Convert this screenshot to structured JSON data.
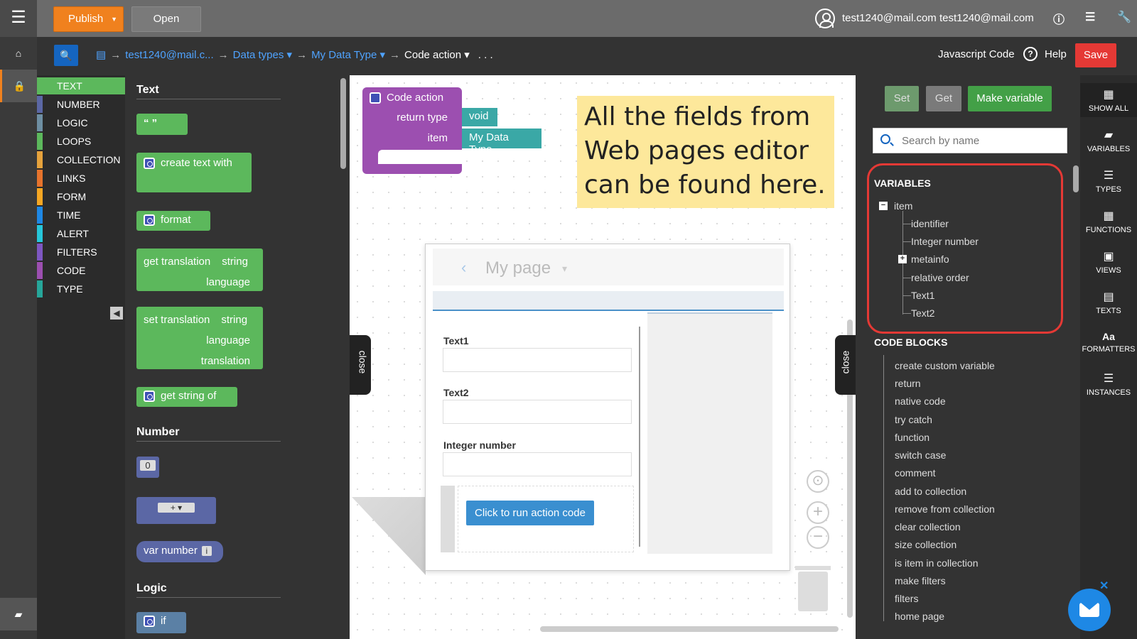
{
  "topbar": {
    "publish_label": "Publish",
    "open_label": "Open",
    "user_email": "test1240@mail.com test1240@mail.com"
  },
  "toolbar": {
    "breadcrumbs": [
      "test1240@mail.c...",
      "Data types",
      "My Data Type",
      "Code action"
    ],
    "more": ". . .",
    "javascript_code": "Javascript Code",
    "help": "Help",
    "save": "Save"
  },
  "categories": [
    {
      "label": "TEXT",
      "color": "#5cb85c"
    },
    {
      "label": "NUMBER",
      "color": "#5b67a5"
    },
    {
      "label": "LOGIC",
      "color": "#6e8fa3"
    },
    {
      "label": "LOOPS",
      "color": "#5cb85c"
    },
    {
      "label": "COLLECTION",
      "color": "#e6a23c"
    },
    {
      "label": "LINKS",
      "color": "#e6732c"
    },
    {
      "label": "FORM",
      "color": "#f5a623"
    },
    {
      "label": "TIME",
      "color": "#1e88e5"
    },
    {
      "label": "ALERT",
      "color": "#26c6da"
    },
    {
      "label": "FILTERS",
      "color": "#7e57c2"
    },
    {
      "label": "CODE",
      "color": "#9c4fb0"
    },
    {
      "label": "TYPE",
      "color": "#26a69a"
    }
  ],
  "flyout": {
    "text_header": "Text",
    "quote_block": "“ ”",
    "create_text_with": "create text with",
    "format": "format",
    "get_translation": "get translation",
    "string": "string",
    "language": "language",
    "set_translation": "set translation",
    "translation": "translation",
    "get_string_of": "get string of",
    "number_header": "Number",
    "zero": "0",
    "plus_op": "+ ▾",
    "var_number": "var number",
    "var_info": "i",
    "logic_header": "Logic",
    "if_label": "if",
    "close": "close"
  },
  "canvas": {
    "code_action": "Code action",
    "return_type": "return type",
    "void": "void",
    "item": "item",
    "my_data_type": "My Data Type",
    "note": "All the fields from Web pages editor can be found here.",
    "page_title": "My page",
    "page_caret": "▾",
    "text1": "Text1",
    "text2": "Text2",
    "integer_number": "Integer number",
    "run_button": "Click to run action code",
    "close": "close"
  },
  "right_panel": {
    "set": "Set",
    "get": "Get",
    "make_variable": "Make variable",
    "search_placeholder": "Search by name",
    "variables_header": "VARIABLES",
    "item": "item",
    "fields": [
      "identifier",
      "Integer number",
      "metainfo",
      "relative order",
      "Text1",
      "Text2"
    ],
    "code_blocks_header": "CODE BLOCKS",
    "code_blocks": [
      "create custom variable",
      "return",
      "native code",
      "try catch",
      "function",
      "switch case",
      "comment",
      "add to collection",
      "remove from collection",
      "clear collection",
      "size collection",
      "is item in collection",
      "make filters",
      "filters",
      "home page"
    ]
  },
  "far_right": [
    {
      "label": "SHOW ALL",
      "icon": "grid-icon"
    },
    {
      "label": "VARIABLES",
      "icon": "book-icon"
    },
    {
      "label": "TYPES",
      "icon": "database-icon"
    },
    {
      "label": "FUNCTIONS",
      "icon": "calculator-icon"
    },
    {
      "label": "VIEWS",
      "icon": "image-icon"
    },
    {
      "label": "TEXTS",
      "icon": "document-icon"
    },
    {
      "label": "FORMATTERS",
      "icon": "font-icon"
    },
    {
      "label": "INSTANCES",
      "icon": "list-icon"
    }
  ]
}
